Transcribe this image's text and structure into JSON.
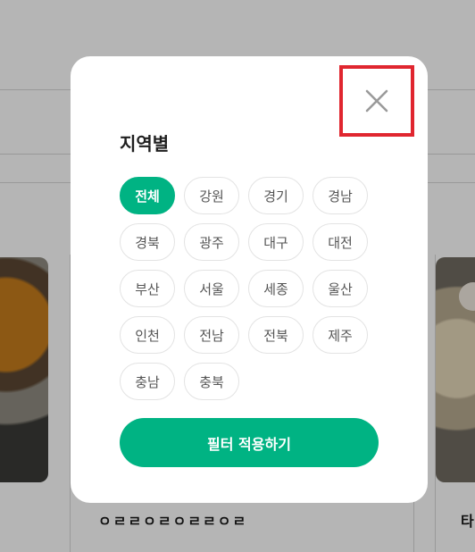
{
  "background": {
    "card_caption": "ㅇㄹㄹㅇㄹㅇㄹㄹㅇㄹ",
    "right_caption": "타"
  },
  "modal": {
    "title": "지역별",
    "close_icon": "close-icon",
    "regions": [
      {
        "label": "전체",
        "selected": true
      },
      {
        "label": "강원",
        "selected": false
      },
      {
        "label": "경기",
        "selected": false
      },
      {
        "label": "경남",
        "selected": false
      },
      {
        "label": "경북",
        "selected": false
      },
      {
        "label": "광주",
        "selected": false
      },
      {
        "label": "대구",
        "selected": false
      },
      {
        "label": "대전",
        "selected": false
      },
      {
        "label": "부산",
        "selected": false
      },
      {
        "label": "서울",
        "selected": false
      },
      {
        "label": "세종",
        "selected": false
      },
      {
        "label": "울산",
        "selected": false
      },
      {
        "label": "인천",
        "selected": false
      },
      {
        "label": "전남",
        "selected": false
      },
      {
        "label": "전북",
        "selected": false
      },
      {
        "label": "제주",
        "selected": false
      },
      {
        "label": "충남",
        "selected": false
      },
      {
        "label": "충북",
        "selected": false
      }
    ],
    "apply_label": "필터 적용하기"
  },
  "colors": {
    "accent": "#00b383",
    "highlight_box": "#e0262f"
  }
}
